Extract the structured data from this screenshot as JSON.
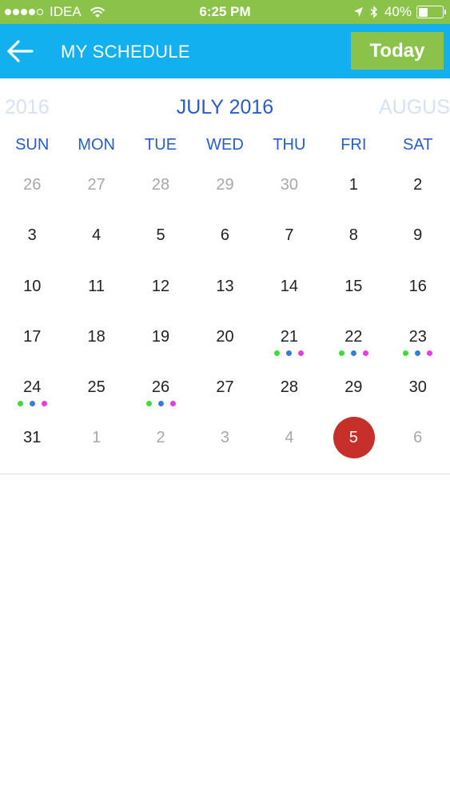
{
  "status_bar": {
    "carrier": "IDEA",
    "time": "6:25 PM",
    "battery_text": "40%",
    "battery_level": 0.4,
    "signal_bars_filled": 4,
    "signal_bars_total": 5
  },
  "header": {
    "title": "MY SCHEDULE",
    "today_label": "Today",
    "colors": {
      "header_bg": "#12b0ef",
      "accent": "#8bc34a"
    }
  },
  "month_nav": {
    "prev_label": "2016",
    "current_label": "JULY 2016",
    "next_label": "AUGUS"
  },
  "weekdays": [
    "SUN",
    "MON",
    "TUE",
    "WED",
    "THU",
    "FRI",
    "SAT"
  ],
  "dot_colors": [
    "#3ddc3d",
    "#3a7bd5",
    "#e83ce0"
  ],
  "selected_color": "#c62f2a",
  "weeks": [
    [
      {
        "day": "26",
        "other": true
      },
      {
        "day": "27",
        "other": true
      },
      {
        "day": "28",
        "other": true
      },
      {
        "day": "29",
        "other": true
      },
      {
        "day": "30",
        "other": true
      },
      {
        "day": "1"
      },
      {
        "day": "2"
      }
    ],
    [
      {
        "day": "3"
      },
      {
        "day": "4"
      },
      {
        "day": "5"
      },
      {
        "day": "6"
      },
      {
        "day": "7"
      },
      {
        "day": "8"
      },
      {
        "day": "9"
      }
    ],
    [
      {
        "day": "10"
      },
      {
        "day": "11"
      },
      {
        "day": "12"
      },
      {
        "day": "13"
      },
      {
        "day": "14"
      },
      {
        "day": "15"
      },
      {
        "day": "16"
      }
    ],
    [
      {
        "day": "17"
      },
      {
        "day": "18"
      },
      {
        "day": "19"
      },
      {
        "day": "20"
      },
      {
        "day": "21",
        "dots": 3
      },
      {
        "day": "22",
        "dots": 3
      },
      {
        "day": "23",
        "dots": 3
      }
    ],
    [
      {
        "day": "24",
        "dots": 3
      },
      {
        "day": "25"
      },
      {
        "day": "26",
        "dots": 3
      },
      {
        "day": "27"
      },
      {
        "day": "28"
      },
      {
        "day": "29"
      },
      {
        "day": "30"
      }
    ],
    [
      {
        "day": "31"
      },
      {
        "day": "1",
        "other": true
      },
      {
        "day": "2",
        "other": true
      },
      {
        "day": "3",
        "other": true
      },
      {
        "day": "4",
        "other": true
      },
      {
        "day": "5",
        "other": true,
        "selected": true
      },
      {
        "day": "6",
        "other": true
      }
    ]
  ]
}
